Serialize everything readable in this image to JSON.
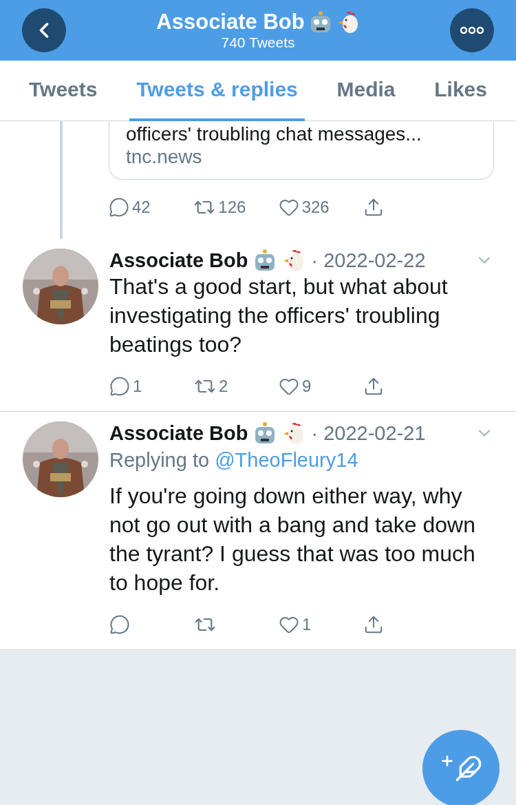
{
  "header": {
    "title": "Associate Bob",
    "subtitle": "740 Tweets"
  },
  "tabs": [
    {
      "label": "Tweets",
      "selected": false
    },
    {
      "label": "Tweets & replies",
      "selected": true
    },
    {
      "label": "Media",
      "selected": false
    },
    {
      "label": "Likes",
      "selected": false
    }
  ],
  "tweets": [
    {
      "kind": "fragment",
      "card_text": "officers' troubling chat messages...",
      "card_domain": "tnc.news",
      "replies": "42",
      "retweets": "126",
      "likes": "326"
    },
    {
      "kind": "tweet",
      "name": "Associate Bob",
      "date": "· 2022-02-22",
      "text": "That's a good start, but what about investigating the officers' troubling beatings too?",
      "replies": "1",
      "retweets": "2",
      "likes": "9"
    },
    {
      "kind": "tweet",
      "name": "Associate Bob",
      "date": "· 2022-02-21",
      "replying_label": "Replying to",
      "replying_to": "@TheoFleury14",
      "text": "If you're going down either way, why not go out with a bang and take down the tyrant? I guess that was too much to hope for.",
      "likes": "1"
    }
  ]
}
